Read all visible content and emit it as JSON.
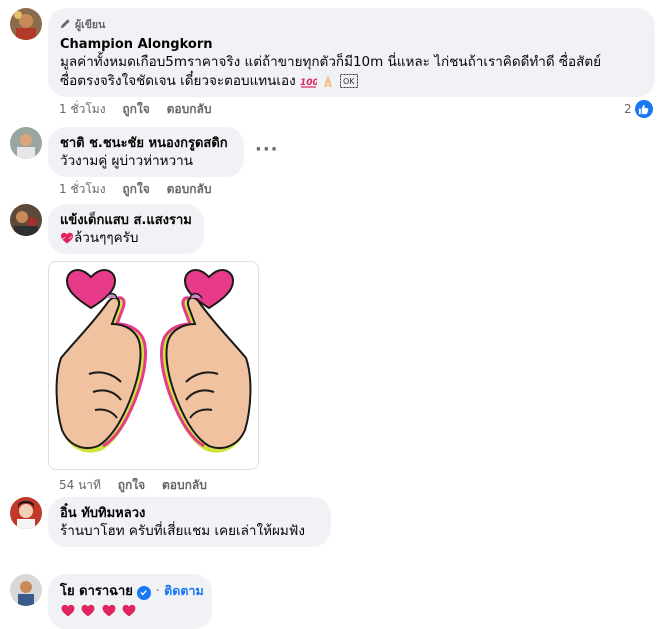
{
  "comments": [
    {
      "author_badge": "ผู้เขียน",
      "name": "Champion Alongkorn",
      "text_line1": "มูลค่าทั้งหมดเกือบ5mราคาจริง แต่ถ้าขายทุกตัวก็มี10m นี่แหละ ไก่ชนถ้าเราคิดดีทำดี ซื่อสัตย์",
      "text_line2": "ซื่อตรงจริงใจชัดเจน เดี๋ยวจะตอบแทนเอง",
      "time": "1 ชั่วโมง",
      "like_label": "ถูกใจ",
      "reply_label": "ตอบกลับ",
      "reaction_count": "2"
    },
    {
      "name": "ชาติ ช.ชนะชัย หนองกรูดสดิก",
      "text": "วัวงามคู่ ผูบ่าวห่าหวาน",
      "time": "1 ชั่วโมง",
      "like_label": "ถูกใจ",
      "reply_label": "ตอบกลับ",
      "more": "···"
    },
    {
      "name": "แข้งเด็กแสบ ส.แสงราม",
      "text": "ล้วนๆๆครับ",
      "time": "54 นาที",
      "like_label": "ถูกใจ",
      "reply_label": "ตอบกลับ"
    },
    {
      "name": "อิ๋น ทับทิมหลวง",
      "text": "ร้านบาโฮท ครับที่เสี่ยแชม เคยเล่าให้ผมฟัง"
    },
    {
      "name": "โย ดาราฉาย",
      "follow": "ติดตาม",
      "separator": "·"
    }
  ],
  "icons": {
    "author": "pencil-icon",
    "reaction": "like-icon",
    "verified": "verified-check-icon",
    "sticker": "finger-heart-sticker"
  },
  "colors": {
    "accent": "#1877f2",
    "bubble": "#f0f2f5",
    "meta": "#65676b",
    "heart": "#e0245e"
  }
}
